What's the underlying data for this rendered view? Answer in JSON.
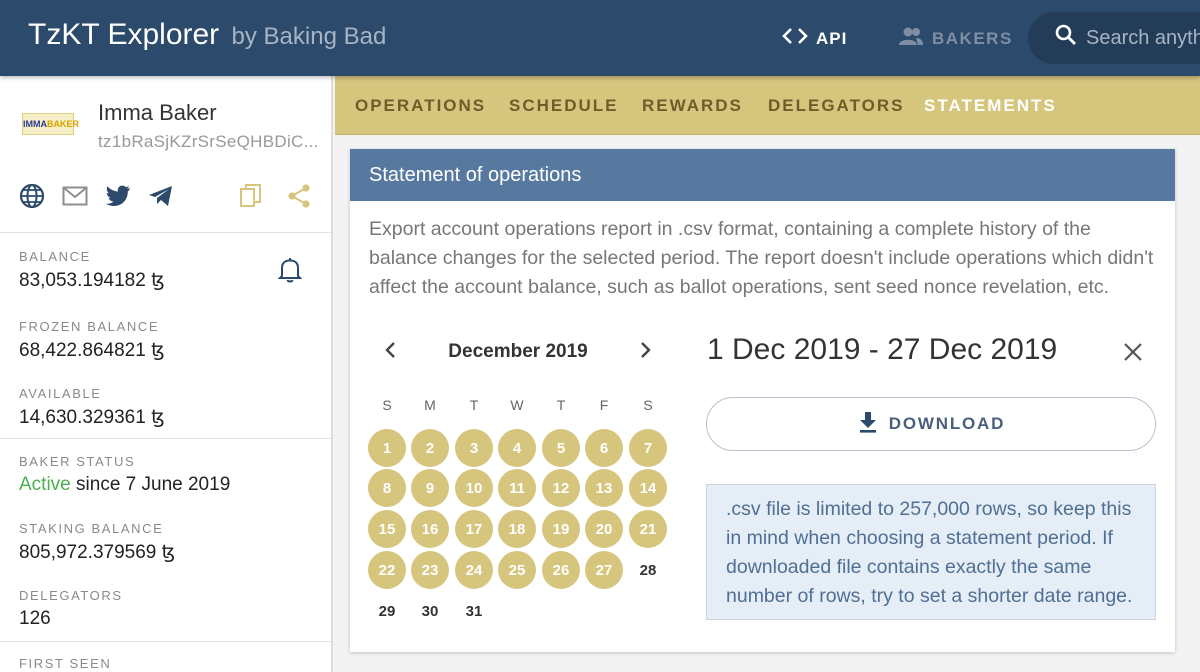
{
  "header": {
    "brand": "TzKT Explorer",
    "brand_by": "by Baking Bad",
    "nav_api": "API",
    "nav_bakers": "BAKERS",
    "search_placeholder": "Search anythi"
  },
  "sidebar": {
    "name": "Imma Baker",
    "address": "tz1bRaSjKZrSrSeQHBDiC...",
    "logo_text_1": "IMMA",
    "logo_text_2": "BAKER",
    "fields": [
      {
        "label": "BALANCE",
        "value": "83,053.194182 ꜩ"
      },
      {
        "label": "FROZEN BALANCE",
        "value": "68,422.864821 ꜩ"
      },
      {
        "label": "AVAILABLE",
        "value": "14,630.329361 ꜩ"
      },
      {
        "label": "BAKER STATUS",
        "value_status": "Active",
        "value_rest": " since 7 June 2019"
      },
      {
        "label": "STAKING BALANCE",
        "value": "805,972.379569 ꜩ"
      },
      {
        "label": "DELEGATORS",
        "value": "126"
      },
      {
        "label": "FIRST SEEN",
        "value": ""
      }
    ]
  },
  "tabs": [
    "OPERATIONS",
    "SCHEDULE",
    "REWARDS",
    "DELEGATORS",
    "STATEMENTS"
  ],
  "active_tab": "STATEMENTS",
  "card": {
    "title": "Statement of operations",
    "description": "Export account operations report in .csv format, containing a complete history of the balance changes for the selected period. The report doesn't include operations which didn't affect the account balance, such as ballot operations, sent seed nonce revelation, etc.",
    "calendar": {
      "month": "December 2019",
      "weekdays": [
        "S",
        "M",
        "T",
        "W",
        "T",
        "F",
        "S"
      ],
      "days": [
        "1",
        "2",
        "3",
        "4",
        "5",
        "6",
        "7",
        "8",
        "9",
        "10",
        "11",
        "12",
        "13",
        "14",
        "15",
        "16",
        "17",
        "18",
        "19",
        "20",
        "21",
        "22",
        "23",
        "24",
        "25",
        "26",
        "27",
        "28",
        "29",
        "30",
        "31"
      ],
      "selected_from": 1,
      "selected_to": 27
    },
    "range": "1 Dec 2019 - 27 Dec 2019",
    "download_label": "DOWNLOAD",
    "note": ".csv file is limited to 257,000 rows, so keep this in mind when choosing a statement period. If downloaded file contains exactly the same number of rows, try to set a shorter date range."
  },
  "colors": {
    "topbar": "#2c4a6b",
    "tabs_bg": "#d6c57d",
    "card_header": "#5779a0",
    "selected_day": "#d6c57d",
    "active_status": "#4caf50"
  }
}
